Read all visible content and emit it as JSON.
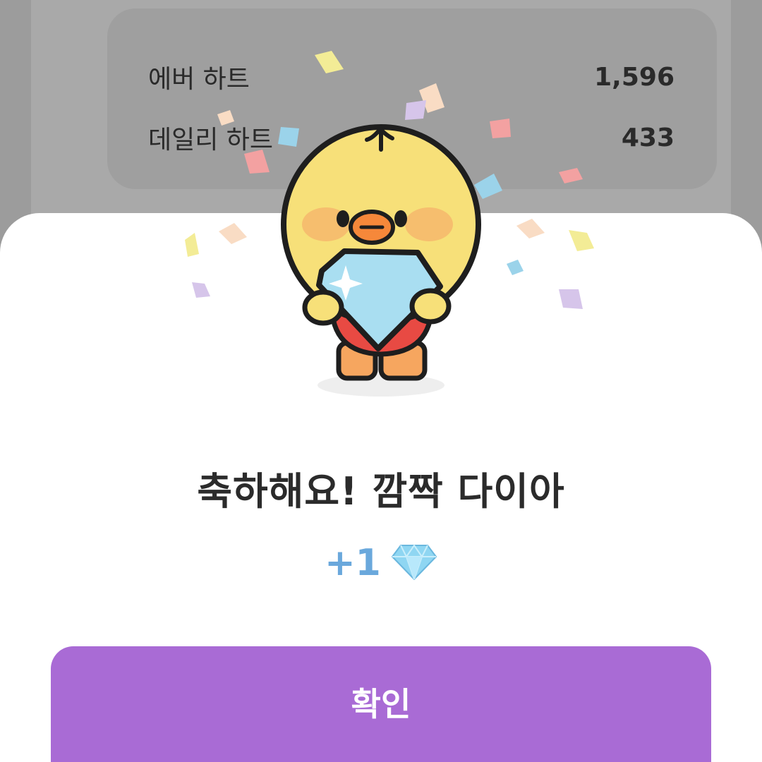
{
  "stats": {
    "ever_heart": {
      "label": "에버 하트",
      "value": "1,596"
    },
    "daily_heart": {
      "label": "데일리 하트",
      "value": "433"
    }
  },
  "dialog": {
    "title": "축하해요! 깜짝 다이아",
    "reward_amount": "+1",
    "reward_icon": "diamond-icon",
    "confirm_label": "확인"
  },
  "colors": {
    "accent": "#a96bd5",
    "reward": "#6aa8dc",
    "overlay": "#9c9c9c"
  }
}
